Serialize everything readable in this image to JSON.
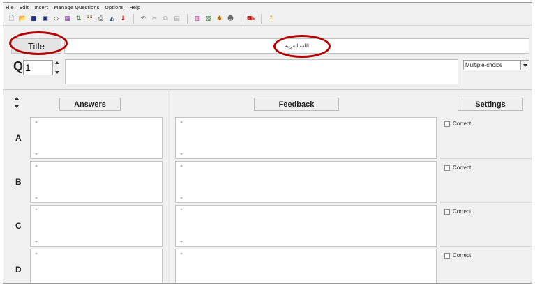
{
  "menu": [
    "File",
    "Edit",
    "Insert",
    "Manage Questions",
    "Options",
    "Help"
  ],
  "toolbar": {
    "group1": [
      {
        "icon": "new-icon",
        "glyph": "🗋",
        "color": "#3b6fb6"
      },
      {
        "icon": "open-icon",
        "glyph": "📂",
        "color": "#d8a400"
      },
      {
        "icon": "save-icon",
        "glyph": "■",
        "color": "#1f2f7a"
      },
      {
        "icon": "save-as-icon",
        "glyph": "▣",
        "color": "#1f2f7a"
      },
      {
        "icon": "diamond-icon",
        "glyph": "◇",
        "color": "#555555"
      },
      {
        "icon": "grid-icon",
        "glyph": "▦",
        "color": "#7a3a9a"
      },
      {
        "icon": "sort-icon",
        "glyph": "⇅",
        "color": "#2f7a2f"
      },
      {
        "icon": "numbering-icon",
        "glyph": "☷",
        "color": "#7a5a00"
      },
      {
        "icon": "print-icon",
        "glyph": "⎙",
        "color": "#444444"
      },
      {
        "icon": "export-icon",
        "glyph": "◭",
        "color": "#2a5a9a"
      },
      {
        "icon": "download-icon",
        "glyph": "⬇",
        "color": "#c01818"
      }
    ],
    "group2": [
      {
        "icon": "undo-icon",
        "glyph": "↶",
        "color": "#777777"
      },
      {
        "icon": "cut-icon",
        "glyph": "✂",
        "color": "#9a9a9a"
      },
      {
        "icon": "copy-icon",
        "glyph": "⧉",
        "color": "#9a9a9a"
      },
      {
        "icon": "paste-icon",
        "glyph": "▤",
        "color": "#9a9a9a"
      }
    ],
    "group3": [
      {
        "icon": "insert-question-icon",
        "glyph": "▥",
        "color": "#b83c9a"
      },
      {
        "icon": "import-icon",
        "glyph": "▧",
        "color": "#3a8a3a"
      },
      {
        "icon": "flow-icon",
        "glyph": "✱",
        "color": "#b06a00"
      },
      {
        "icon": "user-icon",
        "glyph": "☻",
        "color": "#6a6a6a"
      }
    ],
    "group4": [
      {
        "icon": "publish-icon",
        "glyph": "⛟",
        "color": "#c01818"
      }
    ],
    "group5": [
      {
        "icon": "help-icon",
        "glyph": "?",
        "color": "#d4a000"
      }
    ]
  },
  "title": {
    "label": "Title",
    "value": "اللغة العربية"
  },
  "question": {
    "label": "Q",
    "number": "1",
    "text": "",
    "type": "Multiple-choice"
  },
  "headers": {
    "answers": "Answers",
    "feedback": "Feedback",
    "settings": "Settings"
  },
  "rows": [
    {
      "letter": "A",
      "answer": "",
      "feedback": "",
      "correct_label": "Correct",
      "correct": false
    },
    {
      "letter": "B",
      "answer": "",
      "feedback": "",
      "correct_label": "Correct",
      "correct": false
    },
    {
      "letter": "C",
      "answer": "",
      "feedback": "",
      "correct_label": "Correct",
      "correct": false
    },
    {
      "letter": "D",
      "answer": "",
      "feedback": "",
      "correct_label": "Correct",
      "correct": false
    }
  ],
  "colors": {
    "annotation": "#b30000",
    "panel": "#f0f0f0",
    "field": "#ffffff"
  }
}
